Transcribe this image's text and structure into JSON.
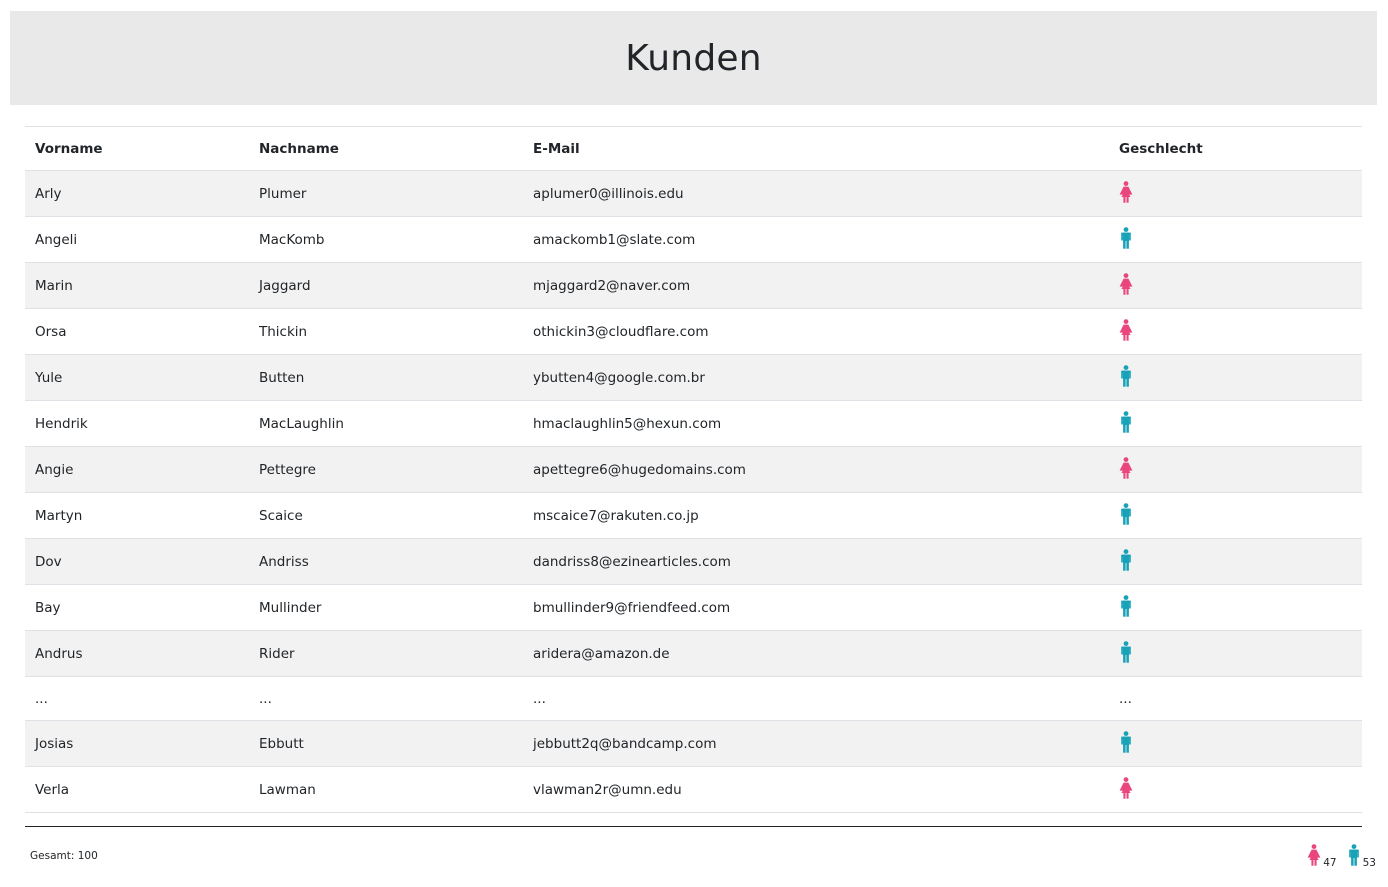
{
  "page": {
    "title": "Kunden"
  },
  "table": {
    "columns": [
      "Vorname",
      "Nachname",
      "E-Mail",
      "Geschlecht"
    ],
    "rows": [
      {
        "first": "Arly",
        "last": "Plumer",
        "email": "aplumer0@illinois.edu",
        "gender": "female"
      },
      {
        "first": "Angeli",
        "last": "MacKomb",
        "email": "amackomb1@slate.com",
        "gender": "male"
      },
      {
        "first": "Marin",
        "last": "Jaggard",
        "email": "mjaggard2@naver.com",
        "gender": "female"
      },
      {
        "first": "Orsa",
        "last": "Thickin",
        "email": "othickin3@cloudflare.com",
        "gender": "female"
      },
      {
        "first": "Yule",
        "last": "Butten",
        "email": "ybutten4@google.com.br",
        "gender": "male"
      },
      {
        "first": "Hendrik",
        "last": "MacLaughlin",
        "email": "hmaclaughlin5@hexun.com",
        "gender": "male"
      },
      {
        "first": "Angie",
        "last": "Pettegre",
        "email": "apettegre6@hugedomains.com",
        "gender": "female"
      },
      {
        "first": "Martyn",
        "last": "Scaice",
        "email": "mscaice7@rakuten.co.jp",
        "gender": "male"
      },
      {
        "first": "Dov",
        "last": "Andriss",
        "email": "dandriss8@ezinearticles.com",
        "gender": "male"
      },
      {
        "first": "Bay",
        "last": "Mullinder",
        "email": "bmullinder9@friendfeed.com",
        "gender": "male"
      },
      {
        "first": "Andrus",
        "last": "Rider",
        "email": "aridera@amazon.de",
        "gender": "male"
      },
      {
        "first": "...",
        "last": "...",
        "email": "...",
        "gender": "...",
        "ellipsis": true
      },
      {
        "first": "Josias",
        "last": "Ebbutt",
        "email": "jebbutt2q@bandcamp.com",
        "gender": "male"
      },
      {
        "first": "Verla",
        "last": "Lawman",
        "email": "vlawman2r@umn.edu",
        "gender": "female"
      }
    ]
  },
  "footer": {
    "total_label": "Gesamt: 100",
    "female_count": "47",
    "male_count": "53"
  },
  "colors": {
    "female": "#e8467c",
    "male": "#17a2b8"
  },
  "icons": {
    "female": "female-icon",
    "male": "male-icon"
  }
}
